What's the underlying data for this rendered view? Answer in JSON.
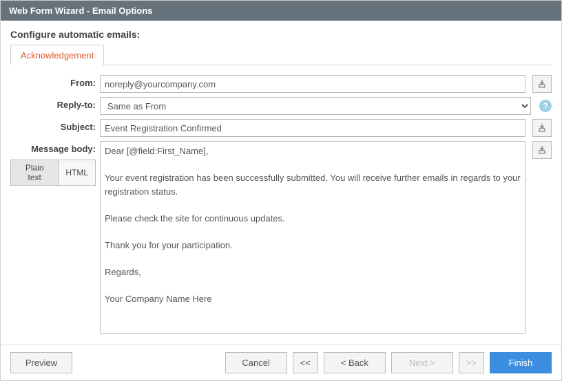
{
  "window": {
    "title": "Web Form Wizard - Email Options"
  },
  "header": {
    "configure_label": "Configure automatic emails:"
  },
  "tabs": {
    "acknowledgement": "Acknowledgement"
  },
  "form": {
    "from_label": "From:",
    "from_value": "noreply@yourcompany.com",
    "replyto_label": "Reply-to:",
    "replyto_value": "Same as From",
    "subject_label": "Subject:",
    "subject_value": "Event Registration Confirmed",
    "body_label": "Message body:",
    "body_value": "Dear [@field:First_Name],\n\nYour event registration has been successfully submitted. You will receive further emails in regards to your registration status.\n\nPlease check the site for continuous updates.\n\nThank you for your participation.\n\nRegards,\n\nYour Company Name Here",
    "format_plain": "Plain text",
    "format_html": "HTML",
    "help_glyph": "?"
  },
  "footer": {
    "preview": "Preview",
    "cancel": "Cancel",
    "first": "<<",
    "back": "< Back",
    "next": "Next >",
    "last": ">>",
    "finish": "Finish"
  }
}
